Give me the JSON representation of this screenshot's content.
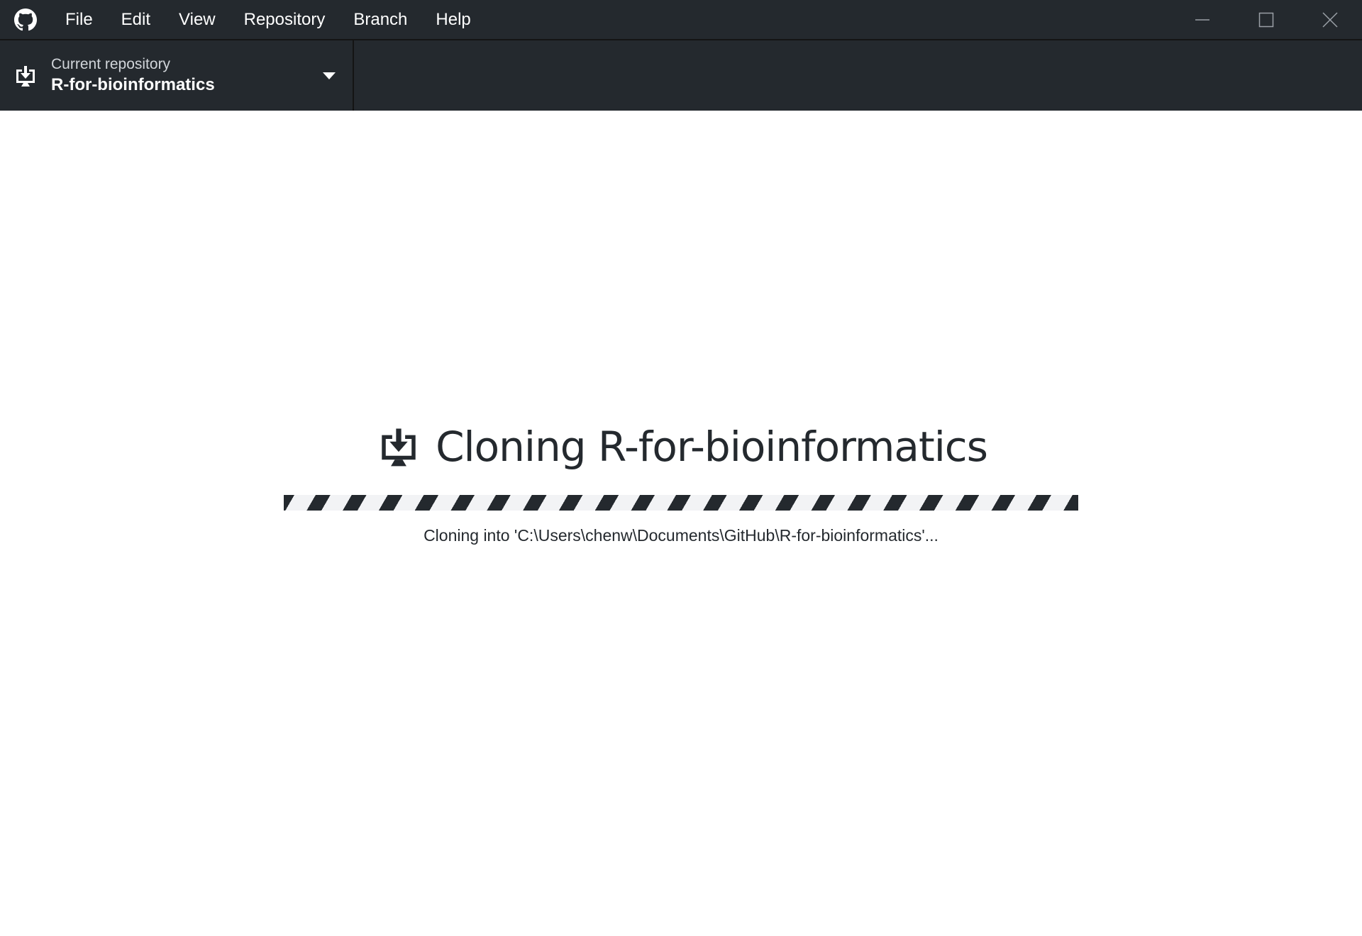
{
  "titlebar": {
    "logo_icon": "github-octocat-icon",
    "menu": [
      {
        "label": "File"
      },
      {
        "label": "Edit"
      },
      {
        "label": "View"
      },
      {
        "label": "Repository"
      },
      {
        "label": "Branch"
      },
      {
        "label": "Help"
      }
    ],
    "window_controls": [
      "minimize-icon",
      "maximize-icon",
      "close-icon"
    ]
  },
  "toolbar": {
    "current_repository": {
      "caption": "Current repository",
      "name": "R-for-bioinformatics",
      "icon": "clone-download-icon",
      "dropdown_icon": "caret-down-icon"
    }
  },
  "main": {
    "icon": "clone-download-icon",
    "title": "Cloning R-for-bioinformatics",
    "progress": 1.0,
    "status": "Cloning into 'C:\\Users\\chenw\\Documents\\GitHub\\R-for-bioinformatics'..."
  },
  "colors": {
    "chrome": "#24292e",
    "border": "#141414",
    "background": "#ffffff",
    "progress_track": "#f2f3f5",
    "text": "#24292e"
  }
}
